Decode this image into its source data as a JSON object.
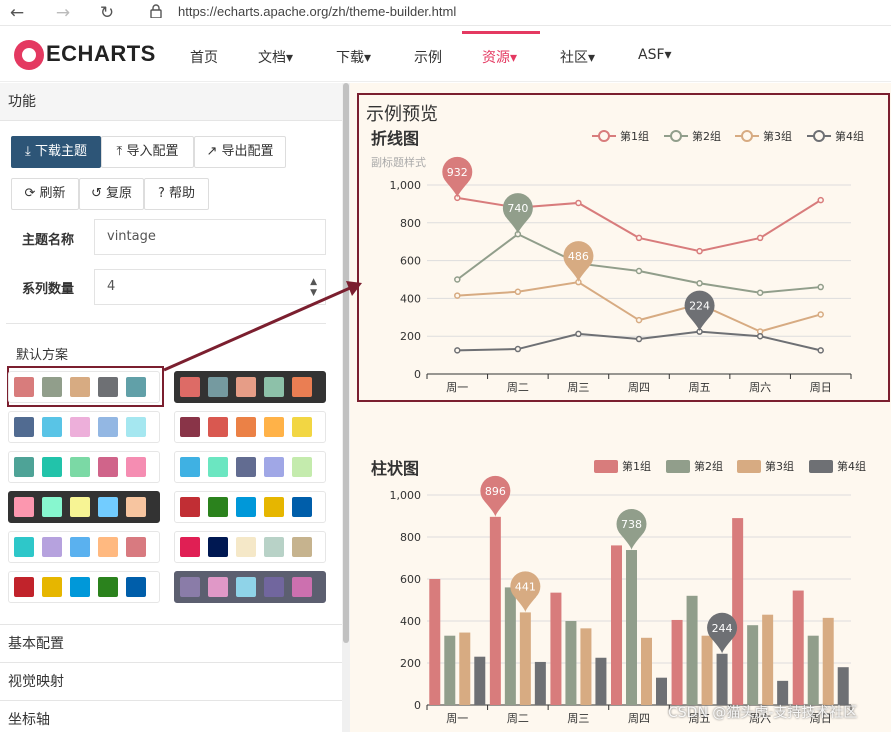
{
  "browser": {
    "url": "https://echarts.apache.org/zh/theme-builder.html"
  },
  "site": {
    "logo": "ECHARTS",
    "nav": [
      "首页",
      "文档▾",
      "下载▾",
      "示例",
      "资源▾",
      "社区▾",
      "ASF▾"
    ],
    "active_nav": "资源▾",
    "brand_color": "#e43961"
  },
  "left": {
    "section_func": "功能",
    "buttons": {
      "download": "下载主题",
      "import": "导入配置",
      "export": "导出配置",
      "refresh": "刷新",
      "reset": "复原",
      "help": "帮助"
    },
    "theme_name_label": "主题名称",
    "theme_name_value": "vintage",
    "series_count_label": "系列数量",
    "series_count_value": "4",
    "default_scheme_label": "默认方案",
    "schemes": [
      {
        "bg": "light",
        "colors": [
          "#d87c7c",
          "#919e8b",
          "#d7ab82",
          "#6e7074",
          "#61a0a8"
        ]
      },
      {
        "bg": "dark",
        "colors": [
          "#dd6b66",
          "#759aa0",
          "#e69d87",
          "#8dc1a9",
          "#ea7e53"
        ]
      },
      {
        "bg": "light",
        "colors": [
          "#516b91",
          "#59c4e6",
          "#edafda",
          "#93b7e3",
          "#a5e7f0"
        ]
      },
      {
        "bg": "light",
        "colors": [
          "#893448",
          "#d95850",
          "#eb8146",
          "#ffb248",
          "#f2d643"
        ]
      },
      {
        "bg": "light",
        "colors": [
          "#4ea397",
          "#22c3aa",
          "#7bd9a5",
          "#d0648a",
          "#f58db2"
        ]
      },
      {
        "bg": "light",
        "colors": [
          "#3fb1e3",
          "#6be6c1",
          "#626c91",
          "#a0a7e6",
          "#c4ebad"
        ]
      },
      {
        "bg": "dark",
        "colors": [
          "#fc97af",
          "#87f7cf",
          "#f7f494",
          "#72ccff",
          "#f7c5a0"
        ]
      },
      {
        "bg": "light",
        "colors": [
          "#c12e34",
          "#2b821d",
          "#0098d9",
          "#e6b600",
          "#005eaa"
        ]
      },
      {
        "bg": "light",
        "colors": [
          "#2ec7c9",
          "#b6a2de",
          "#5ab1ef",
          "#ffb980",
          "#d87a80"
        ]
      },
      {
        "bg": "light",
        "colors": [
          "#e01f54",
          "#001852",
          "#f5e8c8",
          "#b8d2c7",
          "#c6b38e"
        ]
      },
      {
        "bg": "light",
        "colors": [
          "#c1232b",
          "#e6b600",
          "#0098d9",
          "#2b821d",
          "#005eaa"
        ]
      },
      {
        "bg": "purple",
        "colors": [
          "#8a7ca8",
          "#e098c7",
          "#8fd3e8",
          "#71669e",
          "#cc70af"
        ]
      }
    ],
    "sections": [
      "基本配置",
      "视觉映射",
      "坐标轴"
    ]
  },
  "preview": {
    "title": "示例预览",
    "line_chart_title": "折线图",
    "line_chart_subtitle": "副标题样式",
    "bar_chart_title": "柱状图"
  },
  "chart_data": [
    {
      "type": "line",
      "title": "折线图",
      "subtitle": "副标题样式",
      "categories": [
        "周一",
        "周二",
        "周三",
        "周四",
        "周五",
        "周六",
        "周日"
      ],
      "ylim": [
        0,
        1000
      ],
      "yticks": [
        "0",
        "200",
        "400",
        "600",
        "800",
        "1,000"
      ],
      "legend_position": "top-right",
      "series": [
        {
          "name": "第1组",
          "color": "#d87c7c",
          "values": [
            932,
            880,
            905,
            720,
            650,
            720,
            920
          ],
          "marker": {
            "index": 0,
            "label": "932"
          }
        },
        {
          "name": "第2组",
          "color": "#919e8b",
          "values": [
            500,
            740,
            585,
            545,
            480,
            430,
            460
          ],
          "marker": {
            "index": 1,
            "label": "740"
          }
        },
        {
          "name": "第3组",
          "color": "#d7ab82",
          "values": [
            415,
            435,
            486,
            285,
            370,
            225,
            315
          ],
          "marker": {
            "index": 2,
            "label": "486"
          }
        },
        {
          "name": "第4组",
          "color": "#6e7074",
          "values": [
            125,
            132,
            212,
            185,
            224,
            200,
            125
          ],
          "marker": {
            "index": 4,
            "label": "224"
          }
        }
      ]
    },
    {
      "type": "bar",
      "title": "柱状图",
      "categories": [
        "周一",
        "周二",
        "周三",
        "周四",
        "周五",
        "周六",
        "周日"
      ],
      "ylim": [
        0,
        1000
      ],
      "yticks": [
        "0",
        "200",
        "400",
        "600",
        "800",
        "1,000"
      ],
      "legend_position": "top-right",
      "series": [
        {
          "name": "第1组",
          "color": "#d87c7c",
          "values": [
            600,
            896,
            535,
            760,
            405,
            890,
            545
          ],
          "marker": {
            "index": 1,
            "label": "896"
          }
        },
        {
          "name": "第2组",
          "color": "#919e8b",
          "values": [
            330,
            560,
            400,
            738,
            520,
            380,
            330
          ],
          "marker": {
            "index": 3,
            "label": "738"
          }
        },
        {
          "name": "第3组",
          "color": "#d7ab82",
          "values": [
            345,
            441,
            365,
            320,
            330,
            430,
            415
          ],
          "marker": {
            "index": 1,
            "label": "441"
          }
        },
        {
          "name": "第4组",
          "color": "#6e7074",
          "values": [
            230,
            205,
            225,
            130,
            244,
            115,
            180
          ],
          "marker": {
            "index": 4,
            "label": "244"
          }
        }
      ]
    }
  ],
  "annotation": {
    "highlight_color": "#7b1f2f"
  },
  "watermark": "CSDN @猫头虎-支持技术社区"
}
